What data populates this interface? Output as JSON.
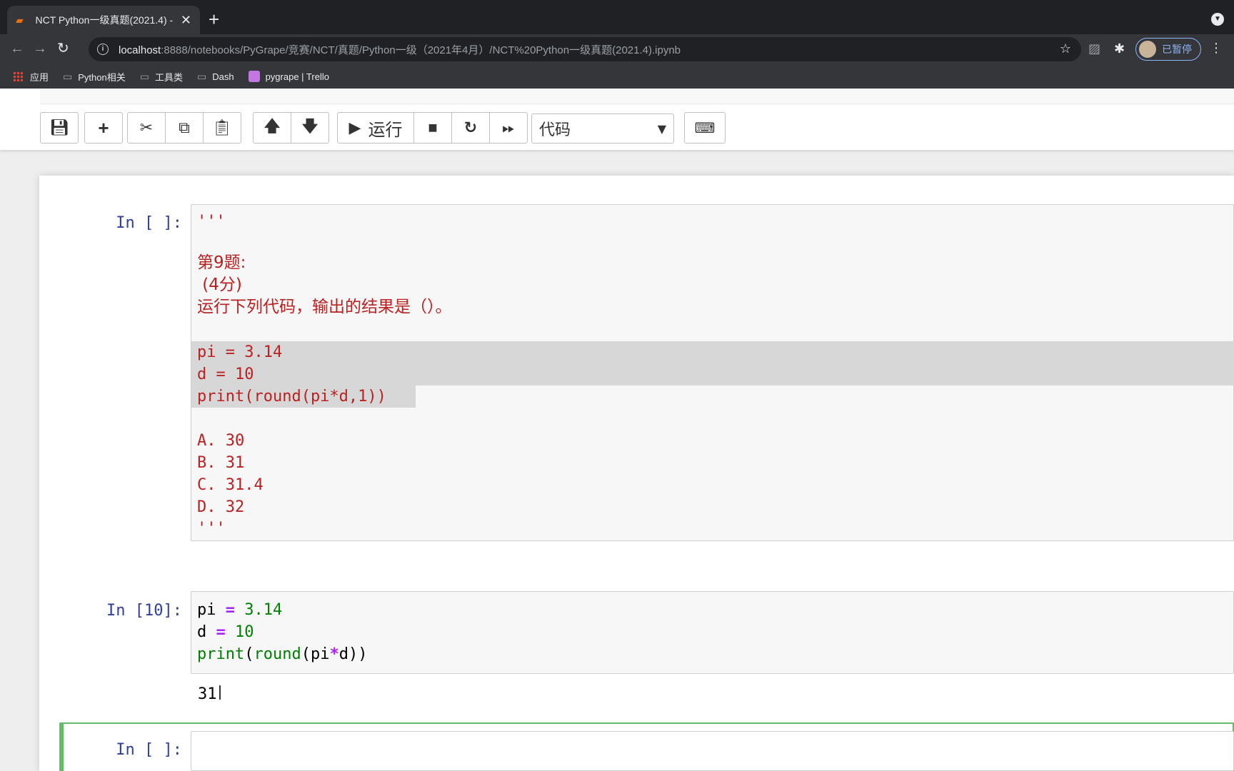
{
  "browser": {
    "tab_title": "NCT Python一级真题(2021.4)",
    "tab_title_suffix": "-",
    "url_host": "localhost",
    "url_path": ":8888/notebooks/PyGrape/竞赛/NCT/真题/Python一级（2021年4月）/NCT%20Python一级真题(2021.4).ipynb",
    "profile_label": "已暂停",
    "bookmarks": [
      {
        "label": "应用",
        "icon": "apps-icon"
      },
      {
        "label": "Python相关",
        "icon": "folder-icon"
      },
      {
        "label": "工具类",
        "icon": "folder-icon"
      },
      {
        "label": "Dash",
        "icon": "folder-icon"
      },
      {
        "label": "pygrape | Trello",
        "icon": "trello-icon"
      }
    ]
  },
  "jupyter": {
    "toolbar": {
      "run_label": "运行",
      "cell_type": "代码"
    }
  },
  "cells": [
    {
      "prompt": "In [ ]:",
      "lines": {
        "l1": "'''",
        "l2": "第9题:",
        "l3": " (4分)",
        "l4": "运行下列代码，输出的结果是（）。",
        "l5": "pi = 3.14",
        "l6": "d = 10",
        "l7": "print(round(pi*d,1))",
        "l8": "A. 30",
        "l9": "B. 31",
        "l10": "C. 31.4",
        "l11": "D. 32",
        "l12": "'''"
      }
    },
    {
      "prompt": "In [10]:",
      "code": {
        "v1": "pi",
        "eq": "=",
        "n1": "3.14",
        "v2": "d",
        "n2": "10",
        "fn1": "print",
        "fn2": "round",
        "arg1": "pi",
        "mul": "*",
        "arg2": "d"
      },
      "output": "31"
    },
    {
      "prompt": "In [ ]:"
    }
  ]
}
